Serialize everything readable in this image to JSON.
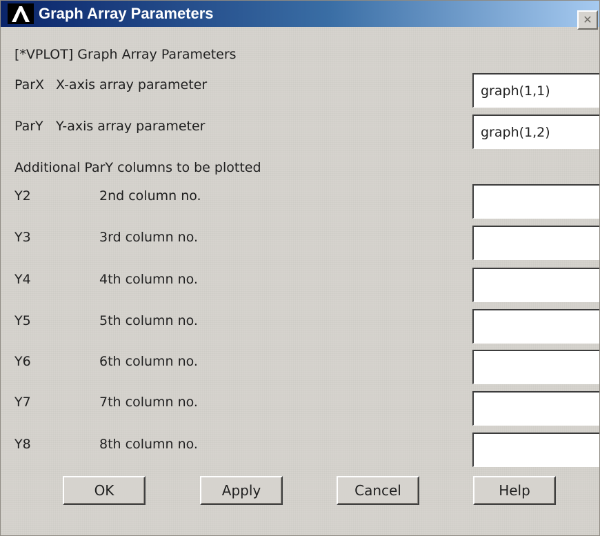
{
  "window": {
    "title": "Graph Array Parameters",
    "close_glyph": "✕"
  },
  "header": {
    "command": "[*VPLOT]  Graph Array Parameters"
  },
  "parx": {
    "tag": "ParX",
    "label": "X-axis array parameter",
    "value": "graph(1,1)"
  },
  "pary": {
    "tag": "ParY",
    "label": "Y-axis array parameter",
    "value": "graph(1,2)"
  },
  "additional": {
    "heading": "Additional ParY columns to be plotted",
    "rows": [
      {
        "tag": "Y2",
        "label": "2nd column no.",
        "value": ""
      },
      {
        "tag": "Y3",
        "label": "3rd column no.",
        "value": ""
      },
      {
        "tag": "Y4",
        "label": "4th column no.",
        "value": ""
      },
      {
        "tag": "Y5",
        "label": "5th column no.",
        "value": ""
      },
      {
        "tag": "Y6",
        "label": "6th column no.",
        "value": ""
      },
      {
        "tag": "Y7",
        "label": "7th column no.",
        "value": ""
      },
      {
        "tag": "Y8",
        "label": "8th column no.",
        "value": ""
      }
    ]
  },
  "buttons": {
    "ok": "OK",
    "apply": "Apply",
    "cancel": "Cancel",
    "help": "Help"
  },
  "icons": {
    "app_logo": "ansys-logo-icon",
    "close": "close-icon"
  },
  "colors": {
    "titlebar_start": "#0a246a",
    "titlebar_end": "#a6caf0",
    "dialog_bg": "#d6d3ce"
  }
}
